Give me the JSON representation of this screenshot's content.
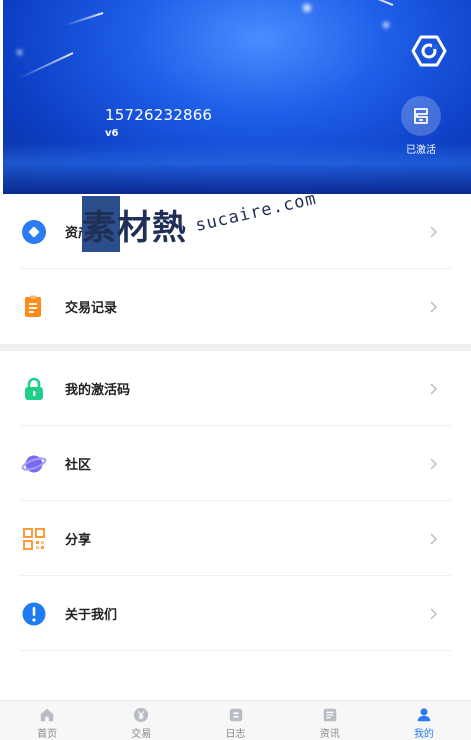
{
  "header": {
    "phone": "15726232866",
    "level": "v6",
    "activated_label": "已激活"
  },
  "menu": {
    "items": [
      {
        "label": "资产",
        "icon": "wallet-icon",
        "color": "#2b7bf5"
      },
      {
        "label": "交易记录",
        "icon": "clipboard-icon",
        "color": "#ff8c1a"
      },
      {
        "label": "我的激活码",
        "icon": "lock-icon",
        "color": "#1fcf8a"
      },
      {
        "label": "社区",
        "icon": "planet-icon",
        "color": "#7a6cf0"
      },
      {
        "label": "分享",
        "icon": "qrcode-icon",
        "color": "#ff9a3c"
      },
      {
        "label": "关于我们",
        "icon": "info-icon",
        "color": "#1f7bf2"
      }
    ]
  },
  "watermark": {
    "cn": "素材熱",
    "url": "sucaire.com"
  },
  "tabbar": {
    "tabs": [
      {
        "label": "首页",
        "icon": "home-icon"
      },
      {
        "label": "交易",
        "icon": "yen-icon"
      },
      {
        "label": "日志",
        "icon": "log-icon"
      },
      {
        "label": "资讯",
        "icon": "news-icon"
      },
      {
        "label": "我的",
        "icon": "user-icon",
        "active": true
      }
    ]
  },
  "colors": {
    "accent": "#2b7bf5",
    "header_blue": "#1e5ee8",
    "tab_inactive": "#b8bcc4"
  }
}
